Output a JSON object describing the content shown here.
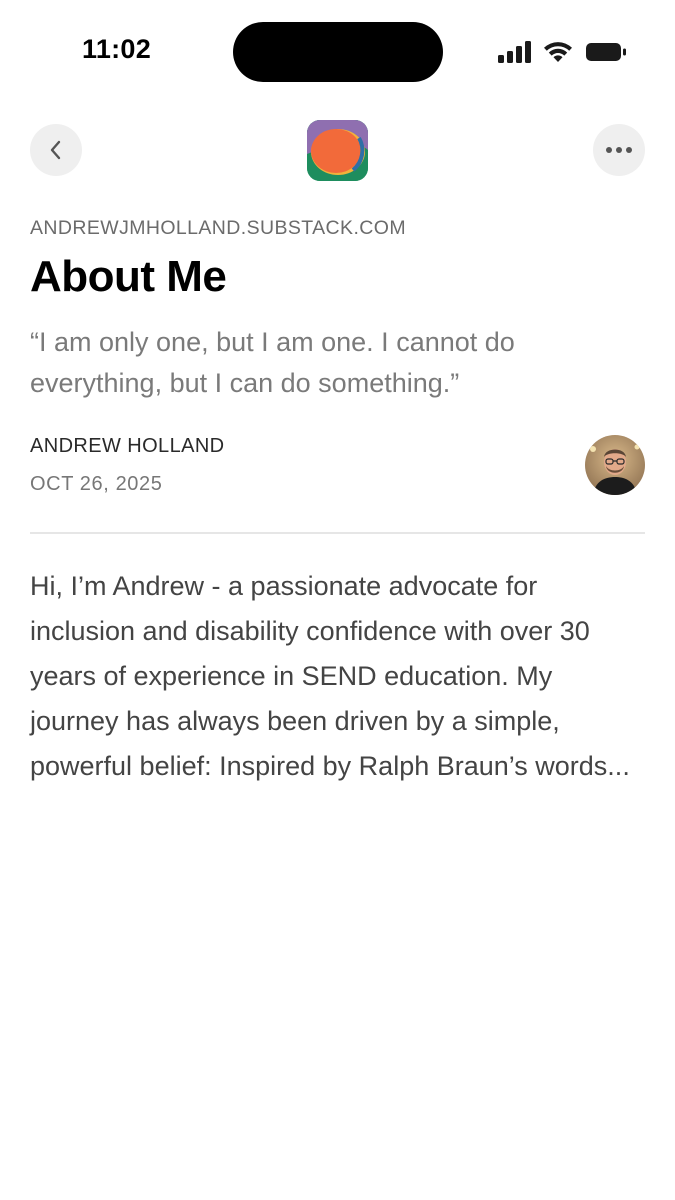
{
  "status_bar": {
    "time": "11:02"
  },
  "nav": {
    "back_icon": "chevron-left-icon",
    "more_icon": "ellipsis-icon",
    "logo": "publication-logo"
  },
  "article": {
    "domain": "ANDREWJMHOLLAND.SUBSTACK.COM",
    "title": "About Me",
    "subtitle": "“I am only one, but I am one. I cannot do everything, but I can do something.”",
    "author": "ANDREW HOLLAND",
    "date": "OCT 26, 2025",
    "body": "Hi, I’m Andrew - a passionate advocate for inclusion and disability confidence with over 30 years of experience in SEND education. My journey has always been driven by a simple, powerful belief: Inspired by Ralph Braun’s words..."
  },
  "colors": {
    "brand_orange": "#f26a3a",
    "brand_green": "#1e8d5e",
    "muted_text": "#7a7a7a",
    "button_bg": "#efefef"
  }
}
